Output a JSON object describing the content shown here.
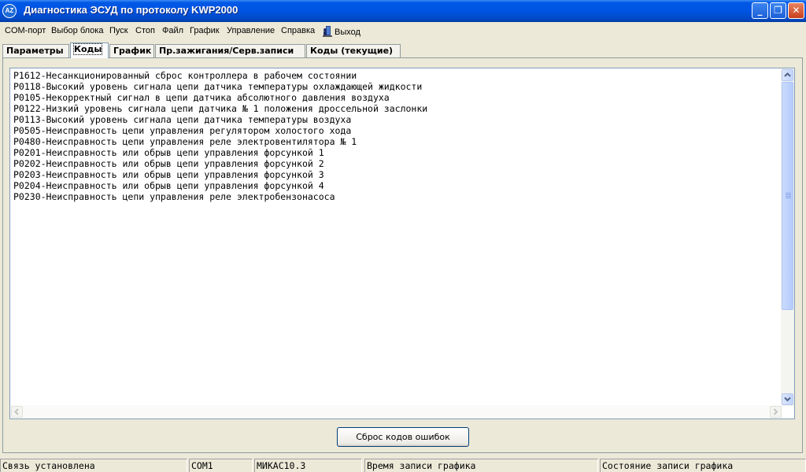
{
  "window": {
    "title": "Диагностика ЭСУД по протоколу KWP2000",
    "icon_text": "AZ",
    "buttons": {
      "minimize": "_",
      "maximize": "❐",
      "close": "✕"
    }
  },
  "menu": {
    "items": [
      "COM-порт",
      "Выбор блока",
      "Пуск",
      "Стоп",
      "Файл",
      "График",
      "Управление",
      "Справка",
      "Выход"
    ]
  },
  "tabs": {
    "items": [
      "Параметры",
      "Коды",
      "График",
      "Пр.зажигания/Серв.записи",
      "Коды (текущие)"
    ],
    "active": "Коды"
  },
  "codes": {
    "lines": [
      "P1612-Несанкционированный сброс контроллера в рабочем состоянии",
      "P0118-Высокий уровень сигнала цепи датчика температуры охлаждающей жидкости",
      "P0105-Некорректный сигнал в цепи датчика абсолютного давления воздуха",
      "P0122-Низкий уровень сигнала цепи датчика № 1 положения дроссельной заслонки",
      "P0113-Высокий уровень сигнала цепи датчика температуры воздуха",
      "P0505-Неисправность цепи управления регулятором холостого хода",
      "P0480-Неисправность цепи управления реле электровентилятора № 1",
      "P0201-Неисправность или обрыв цепи управления форсункой 1",
      "P0202-Неисправность или обрыв цепи управления форсункой 2",
      "P0203-Неисправность или обрыв цепи управления форсункой 3",
      "P0204-Неисправность или обрыв цепи управления форсункой 4",
      "P0230-Неисправность цепи управления реле электробензонасоса"
    ]
  },
  "actions": {
    "reset_codes": "Сброс кодов ошибок"
  },
  "status": {
    "connection": "Связь установлена",
    "port": "COM1",
    "ecu": "МИКАС10.3",
    "record_time": "Время записи графика",
    "record_state": "Состояние записи графика"
  }
}
